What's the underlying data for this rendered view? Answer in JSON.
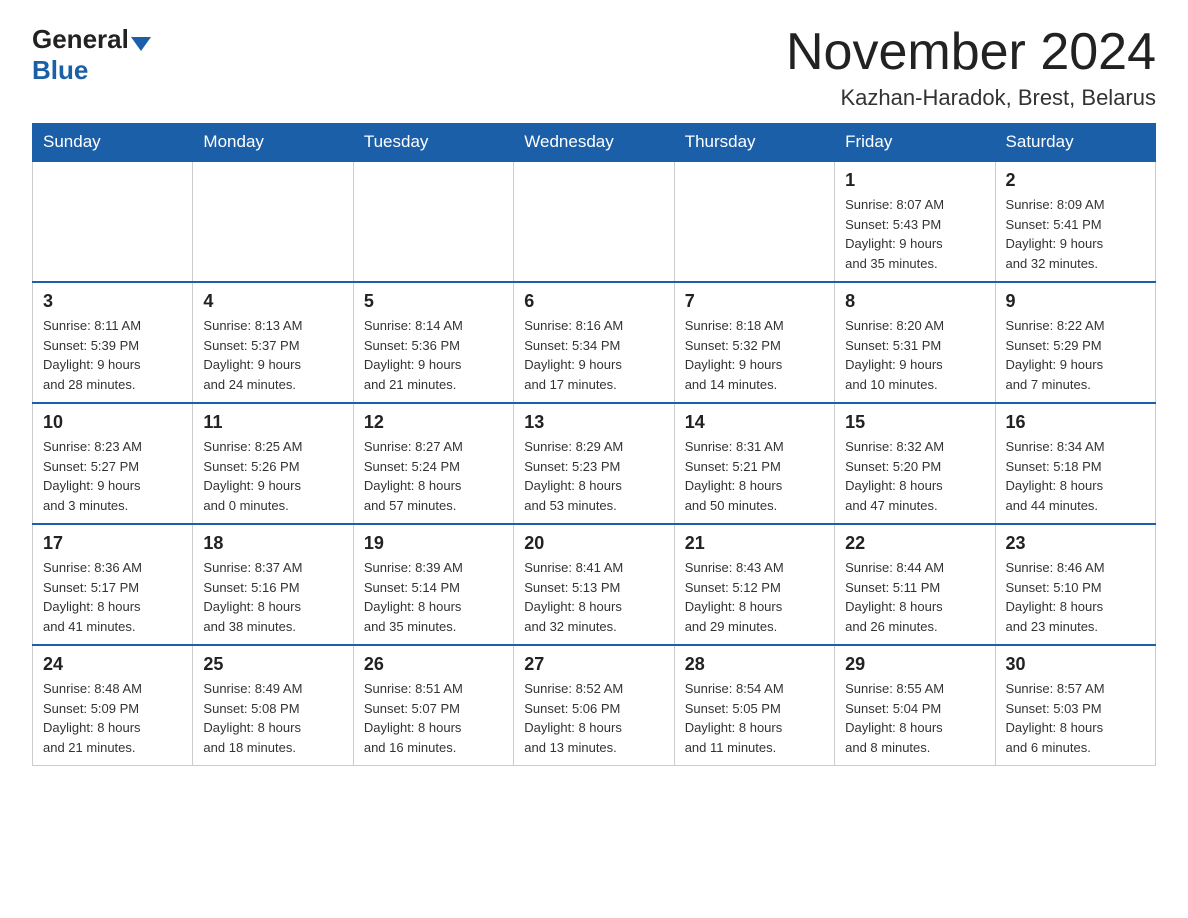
{
  "header": {
    "logo_general": "General",
    "logo_blue": "Blue",
    "month_title": "November 2024",
    "location": "Kazhan-Haradok, Brest, Belarus"
  },
  "weekdays": [
    "Sunday",
    "Monday",
    "Tuesday",
    "Wednesday",
    "Thursday",
    "Friday",
    "Saturday"
  ],
  "weeks": [
    [
      {
        "day": "",
        "info": ""
      },
      {
        "day": "",
        "info": ""
      },
      {
        "day": "",
        "info": ""
      },
      {
        "day": "",
        "info": ""
      },
      {
        "day": "",
        "info": ""
      },
      {
        "day": "1",
        "info": "Sunrise: 8:07 AM\nSunset: 5:43 PM\nDaylight: 9 hours\nand 35 minutes."
      },
      {
        "day": "2",
        "info": "Sunrise: 8:09 AM\nSunset: 5:41 PM\nDaylight: 9 hours\nand 32 minutes."
      }
    ],
    [
      {
        "day": "3",
        "info": "Sunrise: 8:11 AM\nSunset: 5:39 PM\nDaylight: 9 hours\nand 28 minutes."
      },
      {
        "day": "4",
        "info": "Sunrise: 8:13 AM\nSunset: 5:37 PM\nDaylight: 9 hours\nand 24 minutes."
      },
      {
        "day": "5",
        "info": "Sunrise: 8:14 AM\nSunset: 5:36 PM\nDaylight: 9 hours\nand 21 minutes."
      },
      {
        "day": "6",
        "info": "Sunrise: 8:16 AM\nSunset: 5:34 PM\nDaylight: 9 hours\nand 17 minutes."
      },
      {
        "day": "7",
        "info": "Sunrise: 8:18 AM\nSunset: 5:32 PM\nDaylight: 9 hours\nand 14 minutes."
      },
      {
        "day": "8",
        "info": "Sunrise: 8:20 AM\nSunset: 5:31 PM\nDaylight: 9 hours\nand 10 minutes."
      },
      {
        "day": "9",
        "info": "Sunrise: 8:22 AM\nSunset: 5:29 PM\nDaylight: 9 hours\nand 7 minutes."
      }
    ],
    [
      {
        "day": "10",
        "info": "Sunrise: 8:23 AM\nSunset: 5:27 PM\nDaylight: 9 hours\nand 3 minutes."
      },
      {
        "day": "11",
        "info": "Sunrise: 8:25 AM\nSunset: 5:26 PM\nDaylight: 9 hours\nand 0 minutes."
      },
      {
        "day": "12",
        "info": "Sunrise: 8:27 AM\nSunset: 5:24 PM\nDaylight: 8 hours\nand 57 minutes."
      },
      {
        "day": "13",
        "info": "Sunrise: 8:29 AM\nSunset: 5:23 PM\nDaylight: 8 hours\nand 53 minutes."
      },
      {
        "day": "14",
        "info": "Sunrise: 8:31 AM\nSunset: 5:21 PM\nDaylight: 8 hours\nand 50 minutes."
      },
      {
        "day": "15",
        "info": "Sunrise: 8:32 AM\nSunset: 5:20 PM\nDaylight: 8 hours\nand 47 minutes."
      },
      {
        "day": "16",
        "info": "Sunrise: 8:34 AM\nSunset: 5:18 PM\nDaylight: 8 hours\nand 44 minutes."
      }
    ],
    [
      {
        "day": "17",
        "info": "Sunrise: 8:36 AM\nSunset: 5:17 PM\nDaylight: 8 hours\nand 41 minutes."
      },
      {
        "day": "18",
        "info": "Sunrise: 8:37 AM\nSunset: 5:16 PM\nDaylight: 8 hours\nand 38 minutes."
      },
      {
        "day": "19",
        "info": "Sunrise: 8:39 AM\nSunset: 5:14 PM\nDaylight: 8 hours\nand 35 minutes."
      },
      {
        "day": "20",
        "info": "Sunrise: 8:41 AM\nSunset: 5:13 PM\nDaylight: 8 hours\nand 32 minutes."
      },
      {
        "day": "21",
        "info": "Sunrise: 8:43 AM\nSunset: 5:12 PM\nDaylight: 8 hours\nand 29 minutes."
      },
      {
        "day": "22",
        "info": "Sunrise: 8:44 AM\nSunset: 5:11 PM\nDaylight: 8 hours\nand 26 minutes."
      },
      {
        "day": "23",
        "info": "Sunrise: 8:46 AM\nSunset: 5:10 PM\nDaylight: 8 hours\nand 23 minutes."
      }
    ],
    [
      {
        "day": "24",
        "info": "Sunrise: 8:48 AM\nSunset: 5:09 PM\nDaylight: 8 hours\nand 21 minutes."
      },
      {
        "day": "25",
        "info": "Sunrise: 8:49 AM\nSunset: 5:08 PM\nDaylight: 8 hours\nand 18 minutes."
      },
      {
        "day": "26",
        "info": "Sunrise: 8:51 AM\nSunset: 5:07 PM\nDaylight: 8 hours\nand 16 minutes."
      },
      {
        "day": "27",
        "info": "Sunrise: 8:52 AM\nSunset: 5:06 PM\nDaylight: 8 hours\nand 13 minutes."
      },
      {
        "day": "28",
        "info": "Sunrise: 8:54 AM\nSunset: 5:05 PM\nDaylight: 8 hours\nand 11 minutes."
      },
      {
        "day": "29",
        "info": "Sunrise: 8:55 AM\nSunset: 5:04 PM\nDaylight: 8 hours\nand 8 minutes."
      },
      {
        "day": "30",
        "info": "Sunrise: 8:57 AM\nSunset: 5:03 PM\nDaylight: 8 hours\nand 6 minutes."
      }
    ]
  ]
}
